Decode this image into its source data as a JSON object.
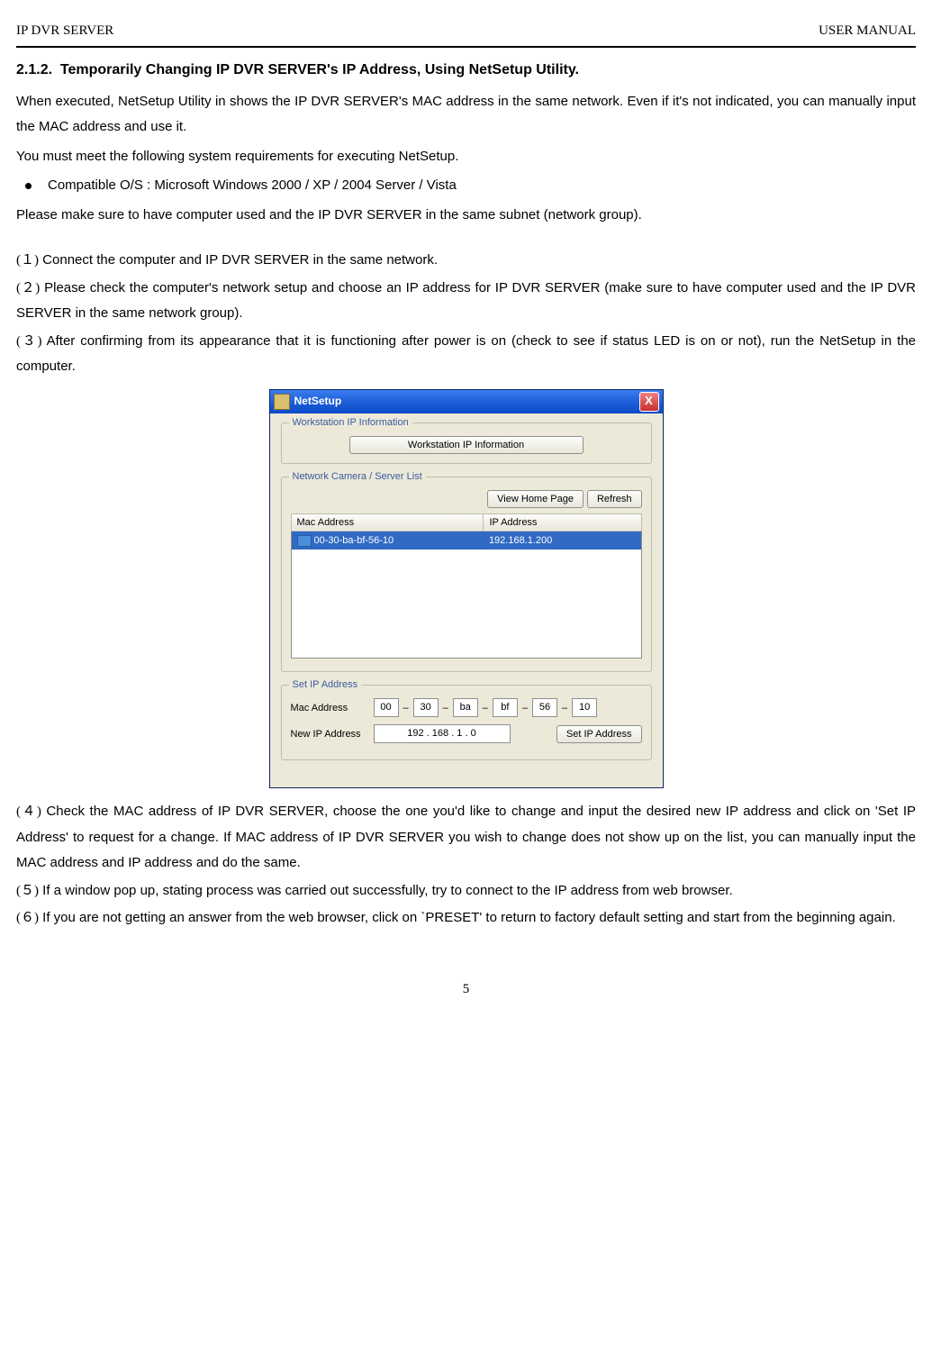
{
  "header": {
    "left": "IP DVR SERVER",
    "right": "USER MANUAL"
  },
  "section": {
    "number": "2.1.2.",
    "title": "Temporarily Changing IP DVR SERVER's IP Address, Using NetSetup Utility."
  },
  "intro": {
    "p1": "When executed, NetSetup Utility in shows the IP DVR SERVER's MAC address in the same network. Even if it's not indicated, you can manually input the MAC address and use it.",
    "p2": "You must meet the following system requirements for executing NetSetup.",
    "bullet": "Compatible O/S : Microsoft Windows 2000 / XP / 2004 Server / Vista",
    "p3": "Please make sure to have computer used and the IP DVR SERVER in the same subnet (network group)."
  },
  "steps": {
    "s1_num": "(１)",
    "s1": "Connect the computer and IP DVR SERVER in the same network.",
    "s2_num": "(２)",
    "s2": "Please check the computer's network setup and choose an IP address for IP DVR SERVER (make sure to have computer used and the IP DVR SERVER in the same network group).",
    "s3_num": "(３)",
    "s3": "After confirming from its appearance that it is functioning after power is on (check to see if status LED is on or not), run the NetSetup in the computer.",
    "s4_num": "(４)",
    "s4": "Check the MAC address of IP DVR SERVER, choose the one you'd like to change and input the desired new IP address and click on 'Set IP Address' to request for a change. If MAC address of IP DVR SERVER you wish to change does not show up on the list, you can manually input the MAC address and IP address and do the same.",
    "s5_num": "(５)",
    "s5": "If a window pop up, stating process was carried out successfully, try to connect to the IP address from web browser.",
    "s6_num": "(６)",
    "s6": "If you are not getting an answer from the web browser, click on `PRESET' to return to factory default setting and start from the beginning again."
  },
  "netsetup": {
    "title": "NetSetup",
    "close": "X",
    "group1": {
      "title": "Workstation IP Information",
      "button": "Workstation IP Information"
    },
    "group2": {
      "title": "Network Camera / Server List",
      "view_btn": "View Home Page",
      "refresh_btn": "Refresh",
      "col_mac": "Mac Address",
      "col_ip": "IP Address",
      "row_mac": "00-30-ba-bf-56-10",
      "row_ip": "192.168.1.200"
    },
    "group3": {
      "title": "Set IP Address",
      "mac_label": "Mac Address",
      "ip_label": "New IP Address",
      "mac": [
        "00",
        "30",
        "ba",
        "bf",
        "56",
        "10"
      ],
      "sep": "–",
      "ip": "192   .   168   .    1    .    0",
      "set_btn": "Set IP Address"
    }
  },
  "page_number": "5"
}
